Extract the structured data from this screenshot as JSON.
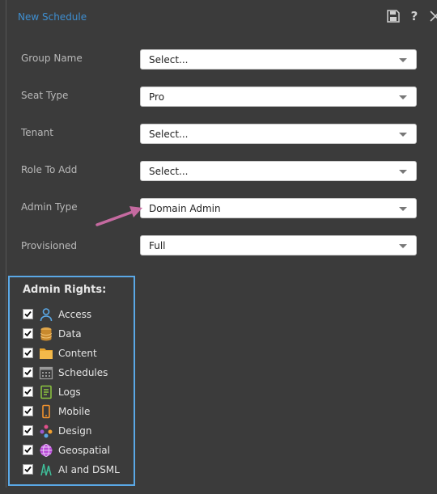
{
  "window": {
    "title": "New Schedule"
  },
  "toolbar": {
    "help_label": "?"
  },
  "form": {
    "rows": [
      {
        "label": "Group Name",
        "value": "Select..."
      },
      {
        "label": "Seat Type",
        "value": "Pro"
      },
      {
        "label": "Tenant",
        "value": "Select..."
      },
      {
        "label": "Role To Add",
        "value": "Select..."
      },
      {
        "label": "Admin Type",
        "value": "Domain Admin"
      },
      {
        "label": "Provisioned",
        "value": "Full"
      }
    ]
  },
  "admin_rights": {
    "title": "Admin Rights:",
    "items": [
      {
        "label": "Access",
        "checked": true,
        "icon": "person-icon"
      },
      {
        "label": "Data",
        "checked": true,
        "icon": "database-icon"
      },
      {
        "label": "Content",
        "checked": true,
        "icon": "folder-icon"
      },
      {
        "label": "Schedules",
        "checked": true,
        "icon": "calendar-icon"
      },
      {
        "label": "Logs",
        "checked": true,
        "icon": "log-icon"
      },
      {
        "label": "Mobile",
        "checked": true,
        "icon": "mobile-icon"
      },
      {
        "label": "Design",
        "checked": true,
        "icon": "palette-icon"
      },
      {
        "label": "Geospatial",
        "checked": true,
        "icon": "globe-icon"
      },
      {
        "label": "AI and DSML",
        "checked": true,
        "icon": "ai-icon"
      }
    ]
  },
  "colors": {
    "accent": "#3e8ed0",
    "highlight_border": "#5aa8e6",
    "annotation_arrow": "#c56aa0"
  }
}
